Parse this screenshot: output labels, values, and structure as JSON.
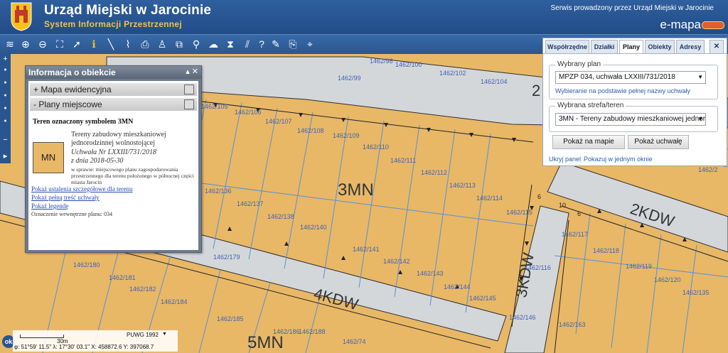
{
  "header": {
    "title": "Urząd Miejski w Jarocinie",
    "subtitle": "System Informacji Przestrzennej",
    "service": "Serwis prowadzony przez Urząd Miejski w Jarocinie",
    "brand": "e-mapa"
  },
  "toolbar": {
    "icons": [
      "layers-icon",
      "zoom-in-icon",
      "zoom-out-icon",
      "zoom-extent-icon",
      "pointer-icon",
      "info-icon",
      "measure-line-icon",
      "measure-area-icon",
      "print-icon",
      "street-view-icon",
      "export-icon",
      "search-icon",
      "comment-icon",
      "clip-icon",
      "hatch-icon",
      "help-icon",
      "draw-icon",
      "pdf-icon",
      "coords-icon"
    ],
    "glyphs": [
      "≋",
      "⊕",
      "⊖",
      "⛶",
      "➚",
      "ℹ",
      "╲",
      "⌇",
      "⎙",
      "♙",
      "⧉",
      "⚲",
      "☁",
      "⧗",
      "⫽",
      "?",
      "✎",
      "⎘",
      "⌖"
    ]
  },
  "leftbar": {
    "plus": "+",
    "minus": "−",
    "expand": "▸"
  },
  "info": {
    "title": "Informacja o obiekcie",
    "controls": "▴ ✕",
    "sections": [
      {
        "label": "+ Mapa ewidencyjna"
      },
      {
        "label": "- Plany miejscowe"
      }
    ],
    "heading": "Teren oznaczony symbolem 3MN",
    "symbol": "MN",
    "desc1": "Tereny zabudowy mieszkaniowej",
    "desc2": "jednorodzinnej wolnostojącej",
    "resolution": "Uchwała Nr LXXIII/731/2018",
    "date": "z dnia 2018-05-30",
    "scope": "w sprawie: miejscowego planu zagospodarowania przestrzennego dla terenu położonego w północnej części miasta Jarocin",
    "links": [
      "Pokaż ustalenia szczegółowe dla terenu",
      "Pokaż pełną treść uchwały",
      "Pokaż legendę"
    ],
    "internal": "Oznaczenie wewnętrzne planu: 034"
  },
  "panel": {
    "tabs": [
      "Współrzędne",
      "Działki",
      "Plany",
      "Obiekty",
      "Adresy"
    ],
    "active_tab": "Plany",
    "plan_legend": "Wybrany plan",
    "plan_value": "MPZP 034, uchwała LXXIII/731/2018",
    "plan_hint": "Wybieranie na podstawie pełnej nazwy uchwały",
    "zone_legend": "Wybrana strefa/teren",
    "zone_value": "3MN - Tereny zabudowy mieszkaniowej jednoro",
    "show_map": "Pokaż na mapie",
    "show_resolution": "Pokaż uchwałę",
    "hide_panel": "Ukryj panel",
    "show_one_window": "Pokazuj w jednym oknie",
    "close": "✕"
  },
  "map": {
    "zones": [
      "3MN",
      "2KDW",
      "3KDW",
      "4KDW",
      "5MN"
    ],
    "parcels": [
      "1462/98",
      "1462/99",
      "1462/100",
      "1462/102",
      "1462/104",
      "1462/105",
      "1462/106",
      "1462/107",
      "1462/108",
      "1462/109",
      "1462/110",
      "1462/111",
      "1462/112",
      "1462/113",
      "1462/114",
      "1462/115",
      "1462/116",
      "1462/117",
      "1462/118",
      "1462/119",
      "1462/120",
      "1462/135",
      "1462/136",
      "1462/137",
      "1462/138",
      "1462/140",
      "1462/141",
      "1462/142",
      "1462/143",
      "1462/144",
      "1462/145",
      "1462/146",
      "1462/163",
      "1462/179",
      "1462/180",
      "1462/181",
      "1462/182",
      "1462/184",
      "1462/185",
      "1462/186",
      "1462/188",
      "1462/74",
      "1462/2"
    ],
    "dims": [
      "6",
      "10",
      "6"
    ],
    "right_cut": "2"
  },
  "status": {
    "scale": "30m",
    "crs": "PUWG 1992",
    "coords": "φ: 51°59' 11.5\" λ: 17°30' 03.1\" X: 458872.6 Y: 397068.7",
    "ok": "ok"
  },
  "colors": {
    "plot": "#e8b867",
    "road": "#d4d7da",
    "line": "#5b8fd6",
    "header": "#2a5690"
  }
}
